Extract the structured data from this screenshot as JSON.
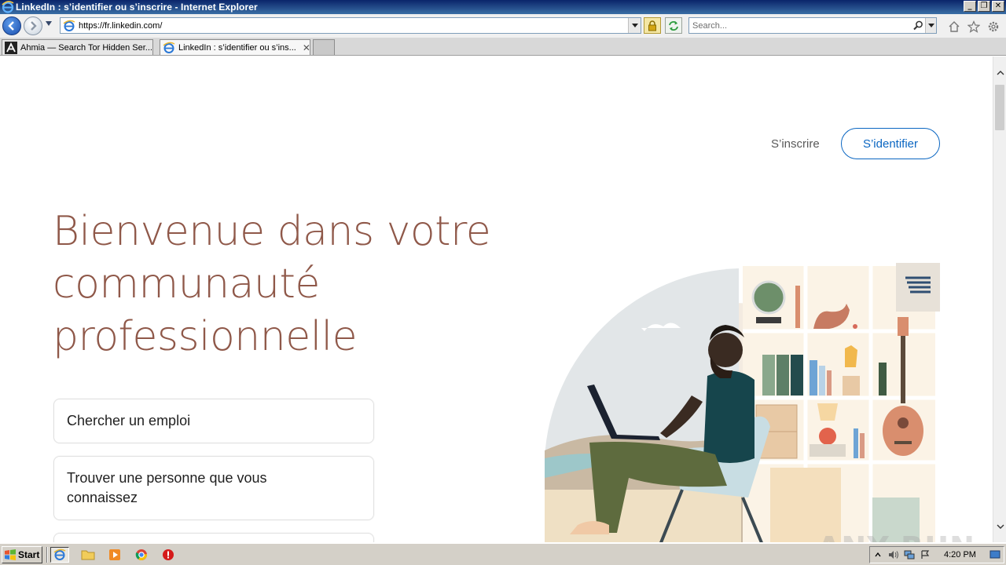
{
  "window": {
    "title": "LinkedIn : s’identifier ou s’inscrire - Internet Explorer",
    "controls": {
      "minimize": "_",
      "restore": "❐",
      "close": "✕"
    }
  },
  "toolbar": {
    "url": "https://fr.linkedin.com/",
    "search_placeholder": "Search..."
  },
  "tabs": [
    {
      "label": "Ahmia — Search Tor Hidden Ser...",
      "active": false,
      "icon": "ahmia-icon"
    },
    {
      "label": "LinkedIn : s’identifier ou s’ins...",
      "active": true,
      "icon": "ie-page-icon"
    }
  ],
  "page": {
    "signup_label": "S’inscrire",
    "signin_label": "S’identifier",
    "hero_lines": [
      "Bienvenue dans votre",
      "communauté",
      "professionnelle"
    ],
    "choices": [
      "Chercher un emploi",
      "Trouver une personne que vous connaissez",
      ""
    ]
  },
  "watermark": "ANY RUN",
  "taskbar": {
    "start_label": "Start",
    "clock": "4:20 PM",
    "quick_launch": [
      "ie-icon",
      "folder-icon",
      "media-player-icon",
      "chrome-icon",
      "stop-icon"
    ]
  },
  "colors": {
    "hero_text": "#8f5849",
    "linkedin_blue": "#0a66c2",
    "titlebar": "#0a246a"
  }
}
